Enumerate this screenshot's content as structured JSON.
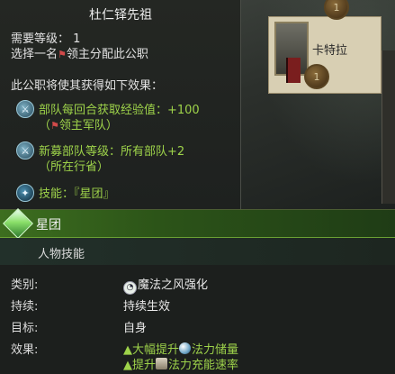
{
  "background": {
    "portrait_name": "卡特拉",
    "medal_top": "1",
    "medal_bottom": "1"
  },
  "tooltip": {
    "title": "杜仁铎先祖",
    "requirement_level": "需要等级： 1",
    "choose_prefix": "选择一名",
    "choose_suffix": "领主分配此公职",
    "effects_header": "此公职将使其获得如下效果：",
    "effect1_line1": "部队每回合获取经验值：+100",
    "effect1_line2_open": "（",
    "effect1_line2_text": "领主军队）",
    "effect2_line1": "新募部队等级：所有部队+2",
    "effect2_line2": "（所在行省）",
    "skill_line": "技能：『星团』"
  },
  "skill": {
    "name": "星团",
    "category": "人物技能",
    "fields": [
      {
        "label": "类别:",
        "value": "魔法之风强化"
      },
      {
        "label": "持续:",
        "value": "持续生效"
      },
      {
        "label": "目标:",
        "value": "自身"
      },
      {
        "label": "效果:",
        "value1_prefix": "▲大幅提升",
        "value1_suffix": "法力储量",
        "value2_prefix": "▲提升",
        "value2_suffix": "法力充能速率"
      }
    ]
  },
  "colors": {
    "accent_green": "#9ed34a",
    "header_green": "#3d6e1f"
  },
  "icons": [
    "sword-arrow-icon",
    "flag-icon",
    "beetle-icon",
    "star-gem-icon",
    "wind-icon",
    "mana-orb-icon",
    "scroll-icon"
  ]
}
